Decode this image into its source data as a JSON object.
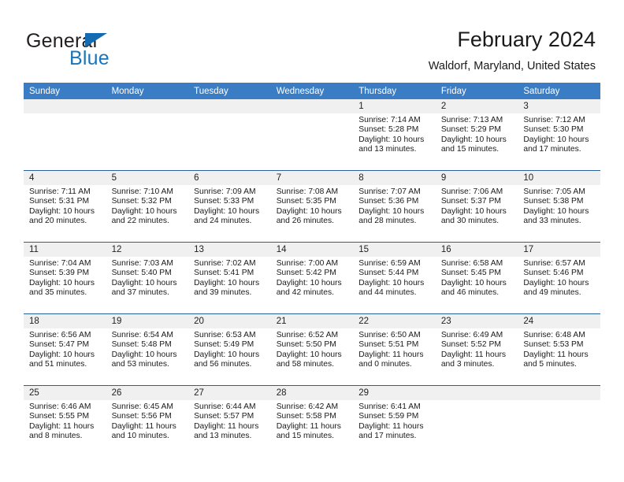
{
  "brand": {
    "name_top": "General",
    "name_bottom": "Blue",
    "triangle_color": "#156bb1",
    "blue_color": "#1b75bb"
  },
  "header": {
    "title": "February 2024",
    "subtitle": "Waldorf, Maryland, United States"
  },
  "colors": {
    "header_bar": "#3b7dc4",
    "row_divider": "#2a6099",
    "daynum_band": "#f0f0f0"
  },
  "weekday_headers": [
    "Sunday",
    "Monday",
    "Tuesday",
    "Wednesday",
    "Thursday",
    "Friday",
    "Saturday"
  ],
  "weeks": [
    [
      {
        "day": "",
        "sunrise": "",
        "sunset": "",
        "daylight1": "",
        "daylight2": ""
      },
      {
        "day": "",
        "sunrise": "",
        "sunset": "",
        "daylight1": "",
        "daylight2": ""
      },
      {
        "day": "",
        "sunrise": "",
        "sunset": "",
        "daylight1": "",
        "daylight2": ""
      },
      {
        "day": "",
        "sunrise": "",
        "sunset": "",
        "daylight1": "",
        "daylight2": ""
      },
      {
        "day": "1",
        "sunrise": "Sunrise: 7:14 AM",
        "sunset": "Sunset: 5:28 PM",
        "daylight1": "Daylight: 10 hours",
        "daylight2": "and 13 minutes."
      },
      {
        "day": "2",
        "sunrise": "Sunrise: 7:13 AM",
        "sunset": "Sunset: 5:29 PM",
        "daylight1": "Daylight: 10 hours",
        "daylight2": "and 15 minutes."
      },
      {
        "day": "3",
        "sunrise": "Sunrise: 7:12 AM",
        "sunset": "Sunset: 5:30 PM",
        "daylight1": "Daylight: 10 hours",
        "daylight2": "and 17 minutes."
      }
    ],
    [
      {
        "day": "4",
        "sunrise": "Sunrise: 7:11 AM",
        "sunset": "Sunset: 5:31 PM",
        "daylight1": "Daylight: 10 hours",
        "daylight2": "and 20 minutes."
      },
      {
        "day": "5",
        "sunrise": "Sunrise: 7:10 AM",
        "sunset": "Sunset: 5:32 PM",
        "daylight1": "Daylight: 10 hours",
        "daylight2": "and 22 minutes."
      },
      {
        "day": "6",
        "sunrise": "Sunrise: 7:09 AM",
        "sunset": "Sunset: 5:33 PM",
        "daylight1": "Daylight: 10 hours",
        "daylight2": "and 24 minutes."
      },
      {
        "day": "7",
        "sunrise": "Sunrise: 7:08 AM",
        "sunset": "Sunset: 5:35 PM",
        "daylight1": "Daylight: 10 hours",
        "daylight2": "and 26 minutes."
      },
      {
        "day": "8",
        "sunrise": "Sunrise: 7:07 AM",
        "sunset": "Sunset: 5:36 PM",
        "daylight1": "Daylight: 10 hours",
        "daylight2": "and 28 minutes."
      },
      {
        "day": "9",
        "sunrise": "Sunrise: 7:06 AM",
        "sunset": "Sunset: 5:37 PM",
        "daylight1": "Daylight: 10 hours",
        "daylight2": "and 30 minutes."
      },
      {
        "day": "10",
        "sunrise": "Sunrise: 7:05 AM",
        "sunset": "Sunset: 5:38 PM",
        "daylight1": "Daylight: 10 hours",
        "daylight2": "and 33 minutes."
      }
    ],
    [
      {
        "day": "11",
        "sunrise": "Sunrise: 7:04 AM",
        "sunset": "Sunset: 5:39 PM",
        "daylight1": "Daylight: 10 hours",
        "daylight2": "and 35 minutes."
      },
      {
        "day": "12",
        "sunrise": "Sunrise: 7:03 AM",
        "sunset": "Sunset: 5:40 PM",
        "daylight1": "Daylight: 10 hours",
        "daylight2": "and 37 minutes."
      },
      {
        "day": "13",
        "sunrise": "Sunrise: 7:02 AM",
        "sunset": "Sunset: 5:41 PM",
        "daylight1": "Daylight: 10 hours",
        "daylight2": "and 39 minutes."
      },
      {
        "day": "14",
        "sunrise": "Sunrise: 7:00 AM",
        "sunset": "Sunset: 5:42 PM",
        "daylight1": "Daylight: 10 hours",
        "daylight2": "and 42 minutes."
      },
      {
        "day": "15",
        "sunrise": "Sunrise: 6:59 AM",
        "sunset": "Sunset: 5:44 PM",
        "daylight1": "Daylight: 10 hours",
        "daylight2": "and 44 minutes."
      },
      {
        "day": "16",
        "sunrise": "Sunrise: 6:58 AM",
        "sunset": "Sunset: 5:45 PM",
        "daylight1": "Daylight: 10 hours",
        "daylight2": "and 46 minutes."
      },
      {
        "day": "17",
        "sunrise": "Sunrise: 6:57 AM",
        "sunset": "Sunset: 5:46 PM",
        "daylight1": "Daylight: 10 hours",
        "daylight2": "and 49 minutes."
      }
    ],
    [
      {
        "day": "18",
        "sunrise": "Sunrise: 6:56 AM",
        "sunset": "Sunset: 5:47 PM",
        "daylight1": "Daylight: 10 hours",
        "daylight2": "and 51 minutes."
      },
      {
        "day": "19",
        "sunrise": "Sunrise: 6:54 AM",
        "sunset": "Sunset: 5:48 PM",
        "daylight1": "Daylight: 10 hours",
        "daylight2": "and 53 minutes."
      },
      {
        "day": "20",
        "sunrise": "Sunrise: 6:53 AM",
        "sunset": "Sunset: 5:49 PM",
        "daylight1": "Daylight: 10 hours",
        "daylight2": "and 56 minutes."
      },
      {
        "day": "21",
        "sunrise": "Sunrise: 6:52 AM",
        "sunset": "Sunset: 5:50 PM",
        "daylight1": "Daylight: 10 hours",
        "daylight2": "and 58 minutes."
      },
      {
        "day": "22",
        "sunrise": "Sunrise: 6:50 AM",
        "sunset": "Sunset: 5:51 PM",
        "daylight1": "Daylight: 11 hours",
        "daylight2": "and 0 minutes."
      },
      {
        "day": "23",
        "sunrise": "Sunrise: 6:49 AM",
        "sunset": "Sunset: 5:52 PM",
        "daylight1": "Daylight: 11 hours",
        "daylight2": "and 3 minutes."
      },
      {
        "day": "24",
        "sunrise": "Sunrise: 6:48 AM",
        "sunset": "Sunset: 5:53 PM",
        "daylight1": "Daylight: 11 hours",
        "daylight2": "and 5 minutes."
      }
    ],
    [
      {
        "day": "25",
        "sunrise": "Sunrise: 6:46 AM",
        "sunset": "Sunset: 5:55 PM",
        "daylight1": "Daylight: 11 hours",
        "daylight2": "and 8 minutes."
      },
      {
        "day": "26",
        "sunrise": "Sunrise: 6:45 AM",
        "sunset": "Sunset: 5:56 PM",
        "daylight1": "Daylight: 11 hours",
        "daylight2": "and 10 minutes."
      },
      {
        "day": "27",
        "sunrise": "Sunrise: 6:44 AM",
        "sunset": "Sunset: 5:57 PM",
        "daylight1": "Daylight: 11 hours",
        "daylight2": "and 13 minutes."
      },
      {
        "day": "28",
        "sunrise": "Sunrise: 6:42 AM",
        "sunset": "Sunset: 5:58 PM",
        "daylight1": "Daylight: 11 hours",
        "daylight2": "and 15 minutes."
      },
      {
        "day": "29",
        "sunrise": "Sunrise: 6:41 AM",
        "sunset": "Sunset: 5:59 PM",
        "daylight1": "Daylight: 11 hours",
        "daylight2": "and 17 minutes."
      },
      {
        "day": "",
        "sunrise": "",
        "sunset": "",
        "daylight1": "",
        "daylight2": ""
      },
      {
        "day": "",
        "sunrise": "",
        "sunset": "",
        "daylight1": "",
        "daylight2": ""
      }
    ]
  ]
}
